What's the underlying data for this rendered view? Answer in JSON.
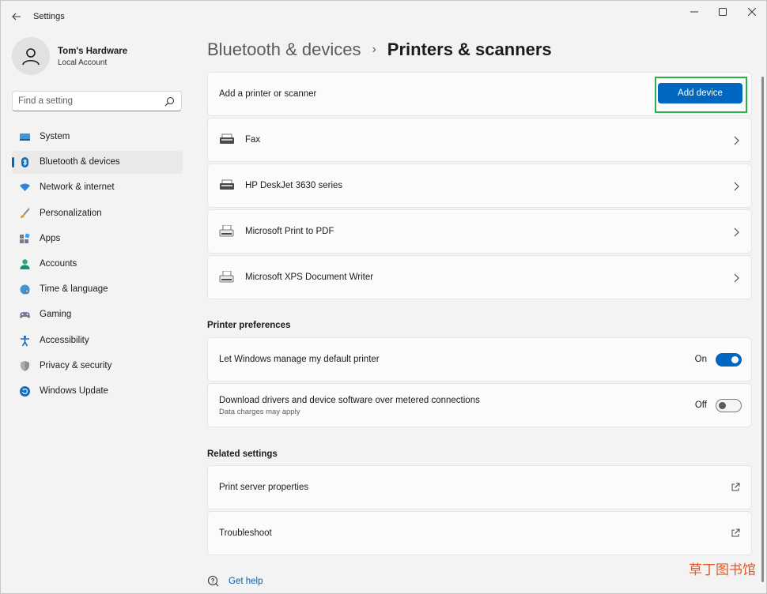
{
  "window": {
    "title": "Settings"
  },
  "profile": {
    "name": "Tom's Hardware",
    "account_type": "Local Account"
  },
  "search": {
    "placeholder": "Find a setting"
  },
  "sidebar": {
    "items": [
      {
        "label": "System",
        "icon": "system-icon",
        "active": false
      },
      {
        "label": "Bluetooth & devices",
        "icon": "bluetooth-icon",
        "active": true
      },
      {
        "label": "Network & internet",
        "icon": "wifi-icon",
        "active": false
      },
      {
        "label": "Personalization",
        "icon": "brush-icon",
        "active": false
      },
      {
        "label": "Apps",
        "icon": "apps-icon",
        "active": false
      },
      {
        "label": "Accounts",
        "icon": "accounts-icon",
        "active": false
      },
      {
        "label": "Time & language",
        "icon": "globe-icon",
        "active": false
      },
      {
        "label": "Gaming",
        "icon": "gamepad-icon",
        "active": false
      },
      {
        "label": "Accessibility",
        "icon": "accessibility-icon",
        "active": false
      },
      {
        "label": "Privacy & security",
        "icon": "shield-icon",
        "active": false
      },
      {
        "label": "Windows Update",
        "icon": "update-icon",
        "active": false
      }
    ]
  },
  "breadcrumb": {
    "parent": "Bluetooth & devices",
    "separator": "›",
    "current": "Printers & scanners"
  },
  "add_printer": {
    "label": "Add a printer or scanner",
    "button": "Add device"
  },
  "printers": [
    {
      "name": "Fax"
    },
    {
      "name": "HP DeskJet 3630 series"
    },
    {
      "name": "Microsoft Print to PDF"
    },
    {
      "name": "Microsoft XPS Document Writer"
    }
  ],
  "printer_preferences": {
    "title": "Printer preferences",
    "items": [
      {
        "label": "Let Windows manage my default printer",
        "state_label": "On",
        "on": true
      },
      {
        "label": "Download drivers and device software over metered connections",
        "sublabel": "Data charges may apply",
        "state_label": "Off",
        "on": false
      }
    ]
  },
  "related_settings": {
    "title": "Related settings",
    "items": [
      {
        "label": "Print server properties"
      },
      {
        "label": "Troubleshoot"
      }
    ]
  },
  "help": {
    "label": "Get help"
  },
  "watermark": "草丁图书馆",
  "colors": {
    "accent": "#0067c0",
    "highlight_border": "#2bb14a",
    "background": "#f3f3f3",
    "card": "#fbfbfb"
  }
}
